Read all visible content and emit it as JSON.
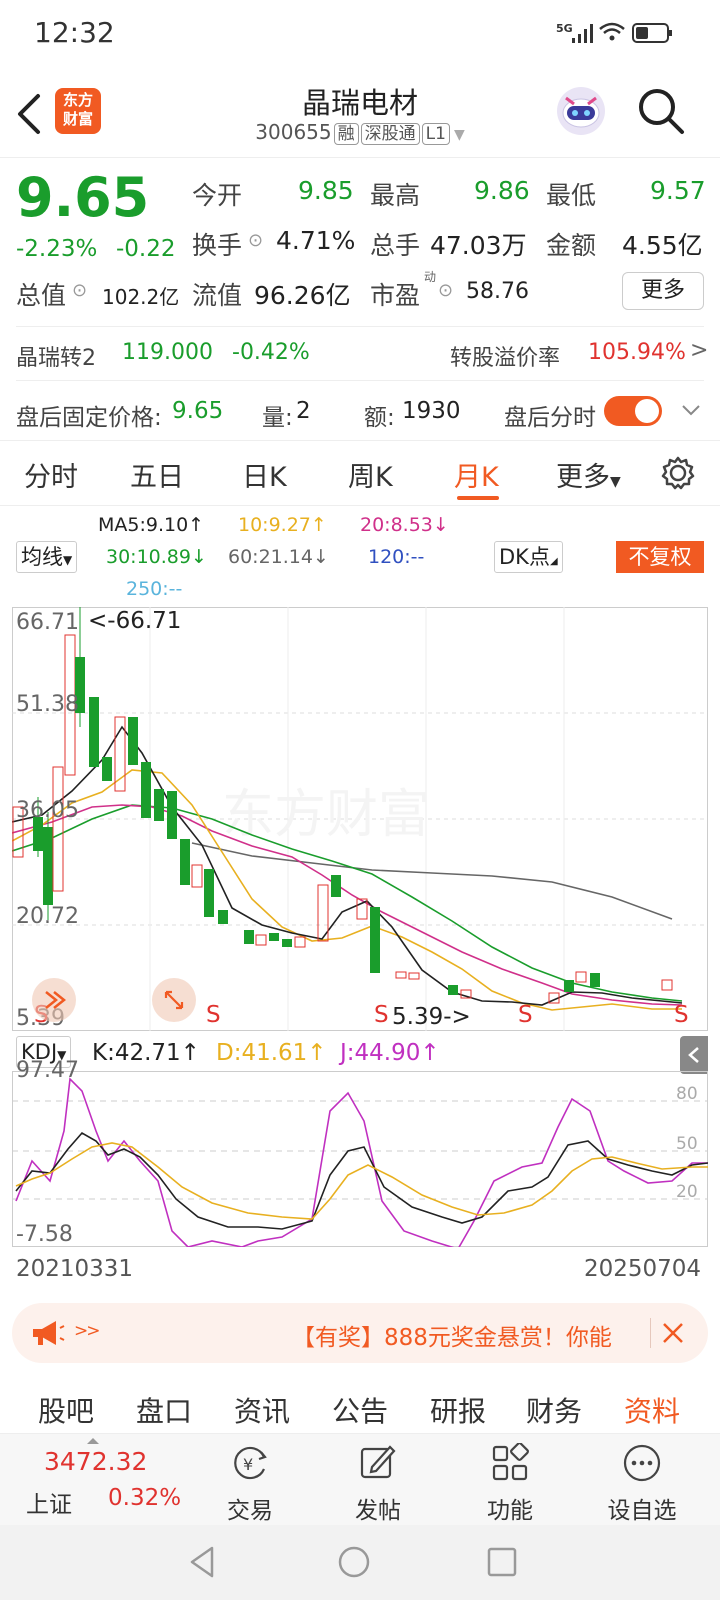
{
  "status": {
    "time": "12:32",
    "net": "5G"
  },
  "header": {
    "title": "晶瑞电材",
    "code": "300655",
    "tags": [
      "融",
      "深股通",
      "L1"
    ],
    "logo_text_line1": "东方",
    "logo_text_line2": "财富"
  },
  "quote": {
    "price": "9.65",
    "change_pct": "-2.23%",
    "change": "-0.22",
    "open_label": "今开",
    "open": "9.85",
    "high_label": "最高",
    "high": "9.86",
    "low_label": "最低",
    "low": "9.57",
    "turnover_label": "换手",
    "turnover": "4.71%",
    "volume_label": "总手",
    "volume": "47.03万",
    "amount_label": "金额",
    "amount": "4.55亿",
    "mktcap_label": "总值",
    "mktcap": "102.2亿",
    "float_label": "流值",
    "float_cap": "96.26亿",
    "pe_label": "市盈",
    "pe_sup": "动",
    "pe": "58.76",
    "more_button": "更多"
  },
  "convertible": {
    "name": "晶瑞转2",
    "price": "119.000",
    "pct": "-0.42%",
    "premium_label": "转股溢价率",
    "premium": "105.94%",
    "arrow": ">"
  },
  "after_hours": {
    "price_label": "盘后固定价格:",
    "price": "9.65",
    "vol_label": "量:",
    "vol": "2",
    "amt_label": "额:",
    "amt": "1930",
    "toggle_label": "盘后分时",
    "toggle_on": true
  },
  "tabs": [
    "分时",
    "五日",
    "日K",
    "周K",
    "月K",
    "更多"
  ],
  "active_tab": "月K",
  "ma": {
    "select": "均线",
    "ma5": "MA5:9.10↑",
    "ma10": "10:9.27↑",
    "ma20": "20:8.53↓",
    "ma30": "30:10.89↓",
    "ma60": "60:21.14↓",
    "ma120": "120:--",
    "ma250": "250:--",
    "dk_select": "DK点",
    "adjust_button": "不复权"
  },
  "price_axis": {
    "max": "66.71",
    "l2": "51.38",
    "l3": "36.05",
    "l4": "20.72",
    "min": "5.39"
  },
  "annotations": {
    "max_marker": "<-66.71",
    "min_marker": "5.39->",
    "s_marker": "S"
  },
  "kdj": {
    "select": "KDJ",
    "k": "K:42.71↑",
    "d": "D:41.61↑",
    "j": "J:44.90↑",
    "top": "97.47",
    "bottom": "-7.58",
    "g80": "80",
    "g50": "50",
    "g20": "20"
  },
  "dates": {
    "start": "20210331",
    "end": "20250704"
  },
  "banner": {
    "text": "【有奖】888元奖金悬赏！你能",
    "arrow": ">>"
  },
  "bottom_tabs": [
    "股吧",
    "盘口",
    "资讯",
    "公告",
    "研报",
    "财务",
    "资料"
  ],
  "active_bottom_tab": "资料",
  "index": {
    "value": "3472.32",
    "name": "上证",
    "pct": "0.32%"
  },
  "tools": [
    "交易",
    "发帖",
    "功能",
    "设自选"
  ],
  "colors": {
    "up": "#e0332f",
    "down": "#1a9d2c",
    "accent": "#f15a22",
    "ma5": "#222222",
    "ma10": "#e8b020",
    "ma20": "#d0308a",
    "ma30": "#1a9d2c",
    "ma60": "#666666"
  }
}
